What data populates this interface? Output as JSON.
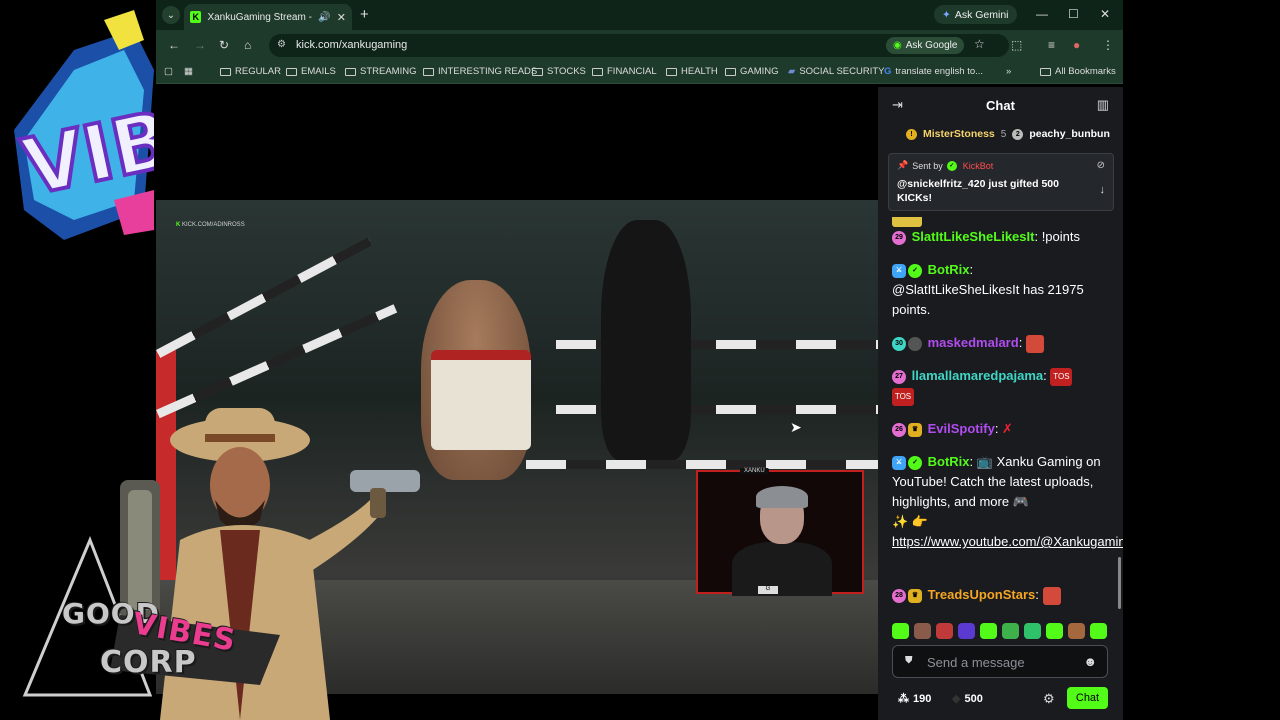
{
  "browser": {
    "tab_title": "XankuGaming Stream - Wa",
    "tab_favicon": "K",
    "ask_gemini": "Ask Gemini",
    "url": "kick.com/xankugaming",
    "ask_google": "Ask Google"
  },
  "bookmarks": [
    {
      "label": "REGULAR",
      "icon": "folder-icon"
    },
    {
      "label": "EMAILS",
      "icon": "folder-icon"
    },
    {
      "label": "STREAMING",
      "icon": "folder-icon"
    },
    {
      "label": "INTERESTING READS",
      "icon": "folder-icon"
    },
    {
      "label": "STOCKS",
      "icon": "folder-icon"
    },
    {
      "label": "FINANCIAL",
      "icon": "folder-icon"
    },
    {
      "label": "HEALTH",
      "icon": "folder-icon"
    },
    {
      "label": "GAMING",
      "icon": "folder-icon"
    },
    {
      "label": "SOCIAL SECURITY",
      "icon": "flag-icon"
    },
    {
      "label": "translate english to...",
      "icon": "google-icon"
    }
  ],
  "all_bookmarks": "All Bookmarks",
  "video": {
    "watermark": "KICK.COM/ADINROSS",
    "webcam_tag": "XANKU",
    "overlay_text_1": "GOOD",
    "overlay_text_2": "VIBES",
    "overlay_text_3": "CORP",
    "logo_text": "VIB"
  },
  "chat": {
    "title": "Chat",
    "leaders": [
      {
        "name": "MisterStoness",
        "count": "5"
      },
      {
        "name": "peachy_bunbun"
      }
    ],
    "pinned": {
      "sent_by_label": "Sent by",
      "sender": "KickBot",
      "text": "@snickelfritz_420 just gifted 500 KICKs!"
    },
    "messages": [
      {
        "badge": "29",
        "user": "SlatItLikeSheLikesIt",
        "color": "#53fc18",
        "text": "!points"
      },
      {
        "user": "BotRix",
        "color": "#53fc18",
        "text": "@SlatItLikeSheLikesIt has 21975 points."
      },
      {
        "badge": "30",
        "user": "maskedmalard",
        "color": "#b04cf0",
        "text": ""
      },
      {
        "badge": "27",
        "user": "llamallamaredpajama",
        "color": "#3fd6c6",
        "text": ""
      },
      {
        "badge": "26",
        "user": "EvilSpotify",
        "color": "#b04cf0",
        "text": ""
      },
      {
        "user": "BotRix",
        "color": "#53fc18",
        "text": "Xanku Gaming on YouTube! Catch the latest uploads, highlights, and more",
        "link": "https://www.youtube.com/@Xankugaming"
      },
      {
        "badge": "28",
        "user": "TreadsUponStars",
        "color": "#f5a623",
        "text": ""
      }
    ],
    "emote_tos": "TOS",
    "input_placeholder": "Send a message",
    "points": "190",
    "kicks": "500",
    "send_label": "Chat"
  }
}
